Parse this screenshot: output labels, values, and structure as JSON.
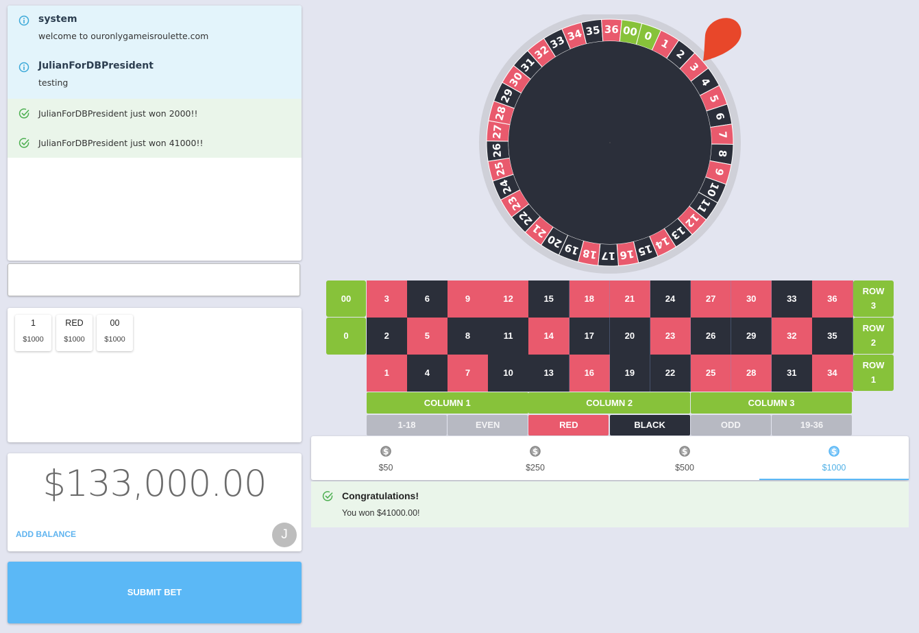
{
  "chat": {
    "messages": [
      {
        "kind": "info",
        "title": "system",
        "body": "welcome to ouronlygameisroulette.com",
        "icon": "info-icon"
      },
      {
        "kind": "info",
        "title": "JulianForDBPresident",
        "body": "testing",
        "icon": "info-icon"
      },
      {
        "kind": "success",
        "body": "JulianForDBPresident just won 2000!!",
        "icon": "check-circle-icon"
      },
      {
        "kind": "success",
        "body": "JulianForDBPresident just won 41000!!",
        "icon": "check-circle-icon"
      }
    ],
    "input_value": ""
  },
  "bets": [
    {
      "target": "1",
      "amount": "$1000"
    },
    {
      "target": "RED",
      "amount": "$1000"
    },
    {
      "target": "00",
      "amount": "$1000"
    }
  ],
  "balance": {
    "amount": "$133,000.00",
    "add_label": "ADD BALANCE",
    "avatar_initial": "J"
  },
  "submit_label": "SUBMIT BET",
  "wheel": {
    "order": [
      "0",
      "1",
      "2",
      "3",
      "4",
      "5",
      "6",
      "7",
      "8",
      "9",
      "10",
      "11",
      "12",
      "13",
      "14",
      "15",
      "16",
      "17",
      "18",
      "19",
      "20",
      "21",
      "22",
      "23",
      "24",
      "25",
      "26",
      "27",
      "28",
      "29",
      "30",
      "31",
      "32",
      "33",
      "34",
      "35",
      "36",
      "00"
    ],
    "pointer_color": "#e8472a"
  },
  "table": {
    "zero_cells": [
      "00",
      "0"
    ],
    "rows": [
      {
        "label_line1": "ROW",
        "label_line2": "3",
        "numbers": [
          "3",
          "6",
          "9",
          "12",
          "15",
          "18",
          "21",
          "24",
          "27",
          "30",
          "33",
          "36"
        ]
      },
      {
        "label_line1": "ROW",
        "label_line2": "2",
        "numbers": [
          "2",
          "5",
          "8",
          "11",
          "14",
          "17",
          "20",
          "23",
          "26",
          "29",
          "32",
          "35"
        ]
      },
      {
        "label_line1": "ROW",
        "label_line2": "1",
        "numbers": [
          "1",
          "4",
          "7",
          "10",
          "13",
          "16",
          "19",
          "22",
          "25",
          "28",
          "31",
          "34"
        ]
      }
    ],
    "red_numbers": [
      "1",
      "3",
      "5",
      "7",
      "9",
      "12",
      "14",
      "16",
      "18",
      "21",
      "23",
      "25",
      "27",
      "28",
      "30",
      "32",
      "34",
      "36"
    ],
    "columns": [
      "COLUMN 1",
      "COLUMN 2",
      "COLUMN 3"
    ],
    "outside": [
      {
        "label": "1-18",
        "color": "grey"
      },
      {
        "label": "EVEN",
        "color": "grey"
      },
      {
        "label": "RED",
        "color": "red"
      },
      {
        "label": "BLACK",
        "color": "black"
      },
      {
        "label": "ODD",
        "color": "grey"
      },
      {
        "label": "19-36",
        "color": "grey"
      }
    ],
    "colors": {
      "red": "#e95a6d",
      "black": "#2b2f3a",
      "green": "#87c23a",
      "grey": "#b7b9c2"
    }
  },
  "chips": {
    "options": [
      "$50",
      "$250",
      "$500",
      "$1000"
    ],
    "selected": "$1000"
  },
  "result": {
    "title": "Congratulations!",
    "body": "You won $41000.00!"
  }
}
